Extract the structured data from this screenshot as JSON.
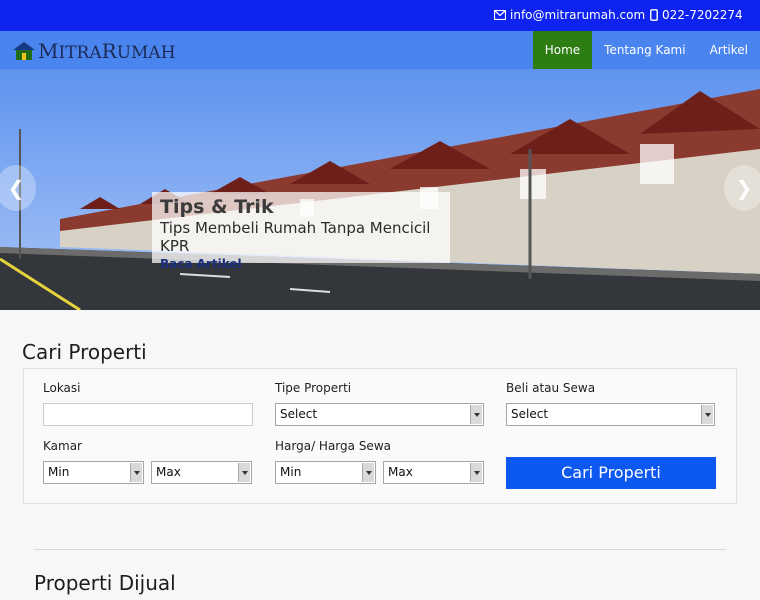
{
  "topbar": {
    "email": "info@mitrarumah.com",
    "phone": "022-7202274",
    "email_icon": "envelope-icon",
    "phone_icon": "mobile-phone-icon"
  },
  "navbar": {
    "logo_icon": "house-icon",
    "logo_text_first": "M",
    "logo_text_rest1": "ITRA",
    "logo_text_second": "R",
    "logo_text_rest2": "UMAH",
    "items": [
      {
        "label": "Home",
        "active": true
      },
      {
        "label": "Tentang Kami",
        "active": false
      },
      {
        "label": "Artikel",
        "active": false
      }
    ]
  },
  "hero": {
    "title": "Tips & Trik",
    "subtitle": "Tips Membeli Rumah Tanpa Mencicil KPR",
    "link": "Baca Artikel",
    "prev": "❮",
    "next": "❯"
  },
  "search": {
    "title": "Cari Properti",
    "lokasi_label": "Lokasi",
    "lokasi_value": "",
    "tipe_label": "Tipe Properti",
    "tipe_value": "Select",
    "beli_label": "Beli atau Sewa",
    "beli_value": "Select",
    "kamar_label": "Kamar",
    "kamar_min": "Min",
    "kamar_max": "Max",
    "harga_label": "Harga/ Harga Sewa",
    "harga_min": "Min",
    "harga_max": "Max",
    "button": "Cari Properti"
  },
  "listing": {
    "title": "Properti Dijual"
  },
  "colors": {
    "topbar": "#0f23f0",
    "navbar": "#4a84ef",
    "nav_active": "#2e7d13",
    "button": "#0d58f0"
  }
}
